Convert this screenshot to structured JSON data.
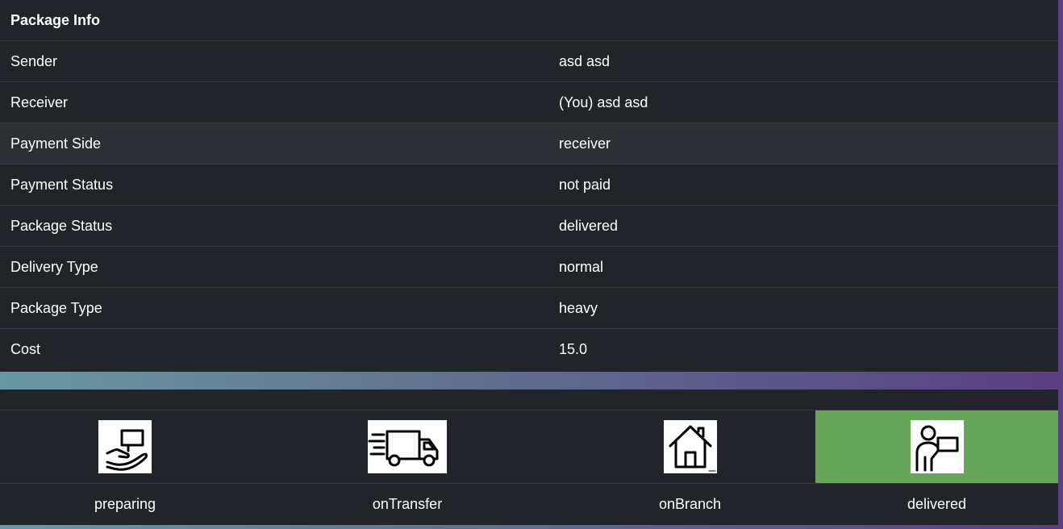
{
  "package_info": {
    "title": "Package Info",
    "rows": [
      {
        "label": "Sender",
        "value": "asd asd"
      },
      {
        "label": "Receiver",
        "value": "(You) asd asd"
      },
      {
        "label": "Payment Side",
        "value": "receiver"
      },
      {
        "label": "Payment Status",
        "value": "not paid"
      },
      {
        "label": "Package Status",
        "value": "delivered"
      },
      {
        "label": "Delivery Type",
        "value": "normal"
      },
      {
        "label": "Package Type",
        "value": "heavy"
      },
      {
        "label": "Cost",
        "value": "15.0"
      }
    ]
  },
  "status_tracker": {
    "active_stage": "delivered",
    "active_color": "#67a55a",
    "stages": [
      {
        "label": "preparing",
        "icon": "hand-holding-package-icon"
      },
      {
        "label": "onTransfer",
        "icon": "delivery-truck-icon"
      },
      {
        "label": "onBranch",
        "icon": "house-icon"
      },
      {
        "label": "delivered",
        "icon": "person-with-package-icon"
      }
    ]
  }
}
